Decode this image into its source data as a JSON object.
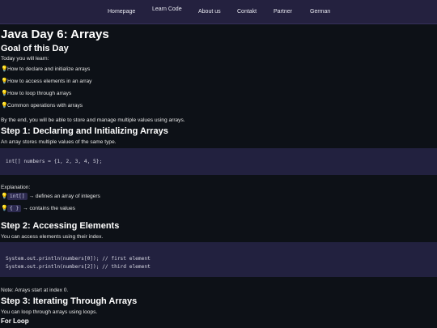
{
  "nav": {
    "items": [
      {
        "label": "Homepage"
      },
      {
        "label": "Learn Code"
      },
      {
        "label": "About us"
      },
      {
        "label": "Contakt"
      },
      {
        "label": "Partner"
      },
      {
        "label": "German"
      }
    ]
  },
  "page": {
    "title": "Java Day 6: Arrays",
    "goal_heading": "Goal of this Day",
    "intro": "Today you will learn:",
    "goals": [
      "How to declare and initialize arrays",
      "How to access elements in an array",
      "How to loop through arrays",
      "Common operations with arrays"
    ],
    "summary": "By the end, you will be able to store and manage multiple values using arrays.",
    "step1": {
      "heading": "Step 1: Declaring and Initializing Arrays",
      "text": "An array stores multiple values of the same type.",
      "code": "int[] numbers = {1, 2, 3, 4, 5};",
      "explanation_label": "Explanation:",
      "items": [
        {
          "chip": "int[]",
          "text": "→ defines an array of integers"
        },
        {
          "chip": "{ }",
          "text": "→ contains the values"
        }
      ]
    },
    "step2": {
      "heading": "Step 2: Accessing Elements",
      "text": "You can access elements using their index.",
      "code_lines": [
        "System.out.println(numbers[0]); // first element",
        "System.out.println(numbers[2]); // third element"
      ],
      "note": "Note: Arrays start at index 0."
    },
    "step3": {
      "heading": "Step 3: Iterating Through Arrays",
      "text": "You can loop through arrays using loops.",
      "subheading": "For Loop"
    }
  },
  "icons": {
    "bullet": "lightbulb-icon"
  },
  "colors": {
    "background": "#0d1117",
    "nav": "#24213f",
    "code_bg": "#22213f",
    "bulb": "#f6c945"
  }
}
